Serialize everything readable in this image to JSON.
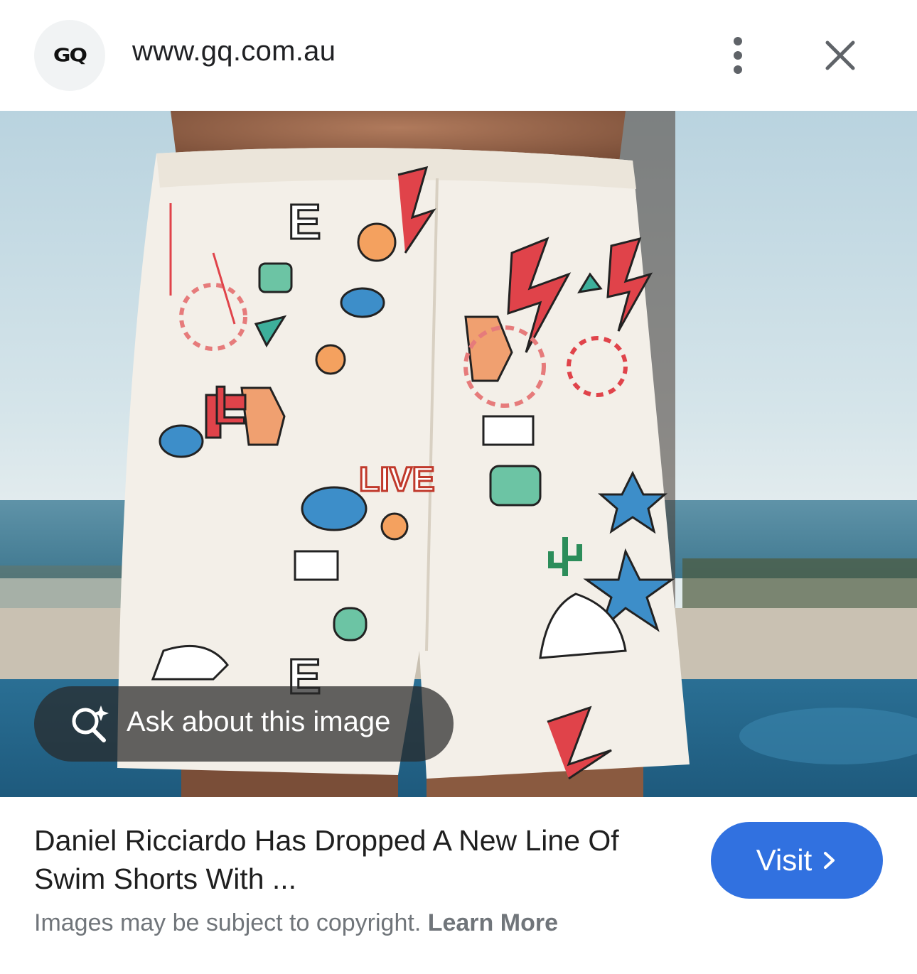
{
  "header": {
    "favicon_text": "GQ",
    "url": "www.gq.com.au",
    "more_icon": "more-vert-icon",
    "close_icon": "close-icon"
  },
  "image": {
    "ask_label": "Ask about this image",
    "ask_icon": "lens-sparkle-icon",
    "print_words": [
      "E",
      "L",
      "LIVE",
      "E"
    ]
  },
  "result": {
    "title": "Daniel Ricciardo Has Dropped A New Line Of Swim Shorts With ...",
    "visit_label": "Visit",
    "visit_icon": "chevron-right-icon",
    "copyright_text": "Images may be subject to copyright.",
    "learn_more": "Learn More"
  },
  "colors": {
    "visit_button": "#3171e0",
    "chip_background": "#282828",
    "text_primary": "#1f1f1f",
    "text_secondary": "#70757a"
  }
}
